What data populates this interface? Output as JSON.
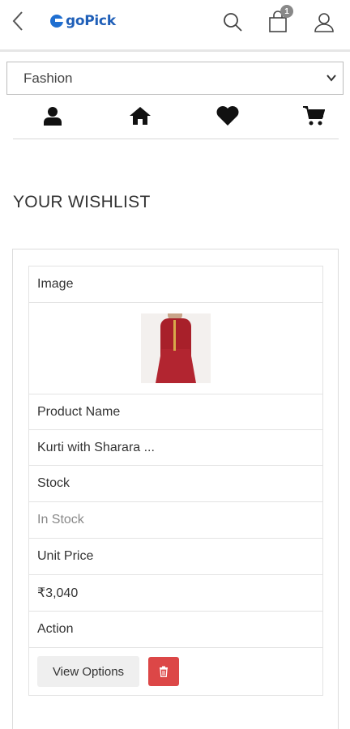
{
  "header": {
    "logo_text": "goPick",
    "cart_count": "1"
  },
  "category": {
    "selected": "Fashion"
  },
  "quick_nav": [
    "user-icon",
    "home-icon",
    "heart-icon",
    "cart-icon"
  ],
  "page": {
    "title": "YOUR WISHLIST"
  },
  "wishlist": {
    "image_header": "Image",
    "product_name_header": "Product Name",
    "product_name": "Kurti with Sharara ...",
    "stock_header": "Stock",
    "stock_value": "In Stock",
    "price_header": "Unit Price",
    "price_value": "₹3,040",
    "action_header": "Action",
    "view_options_label": "View Options"
  },
  "colors": {
    "brand": "#1f5fb8",
    "delete": "#dc4747",
    "stock_text": "#888888"
  }
}
